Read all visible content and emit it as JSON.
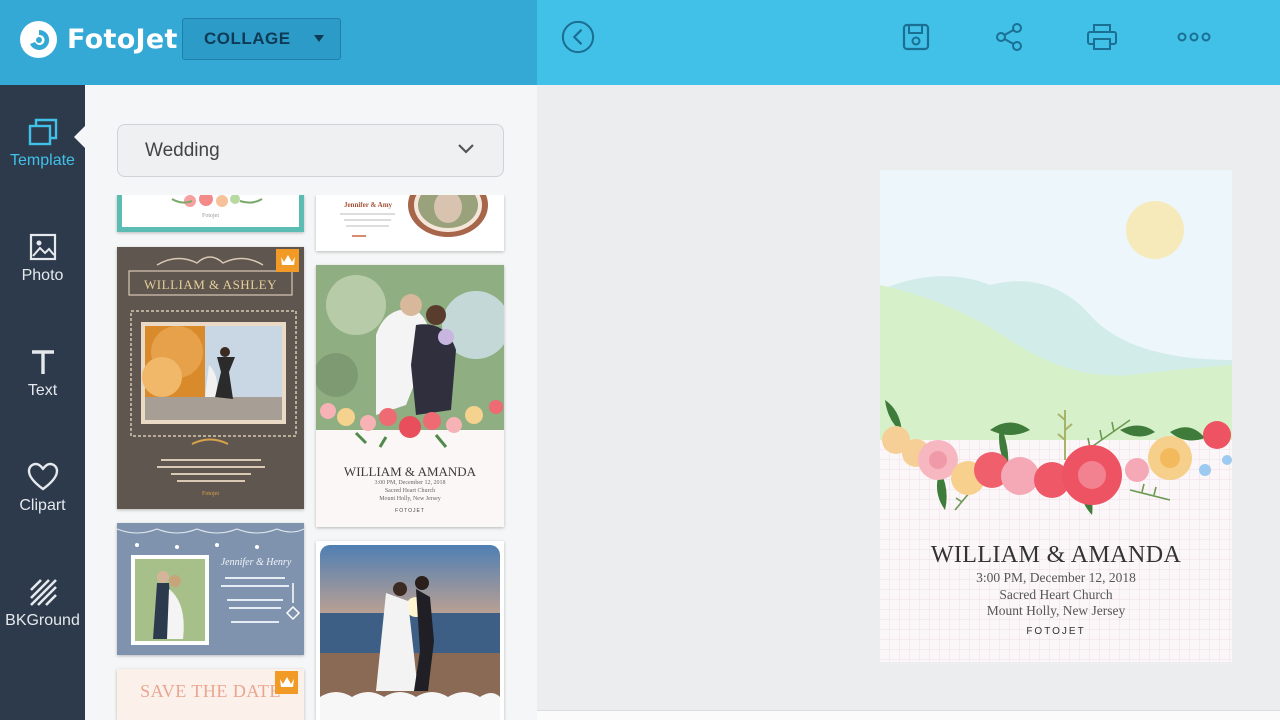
{
  "app": {
    "name": "FotoJet",
    "mode": "COLLAGE"
  },
  "toolbar": {
    "back": "back-icon",
    "save": "save-icon",
    "share": "share-icon",
    "print": "print-icon",
    "more": "more-icon"
  },
  "rail": {
    "items": [
      {
        "label": "Template",
        "icon": "template-icon",
        "active": true
      },
      {
        "label": "Photo",
        "icon": "photo-icon"
      },
      {
        "label": "Text",
        "icon": "text-icon"
      },
      {
        "label": "Clipart",
        "icon": "heart-icon"
      },
      {
        "label": "BKGround",
        "icon": "background-icon"
      }
    ]
  },
  "panel": {
    "category": "Wedding",
    "templates": [
      {
        "top_text": "Fotojet"
      },
      {
        "names": "Jennifer & Amy"
      },
      {
        "names": "WILLIAM & ASHLEY",
        "details": [
          "VILLA DESTE, LAKE COMO, ITALY",
          "SUNDAY 7 O'CLOCK SEPTEMBER 12, 2018",
          "DRESS CODE IS FORMAL",
          "WELCOME TO ATTEND"
        ],
        "brand": "Fotojet",
        "premium": true
      },
      {
        "names": "WILLIAM & AMANDA",
        "details": [
          "3:00 PM, December 12, 2018",
          "Sacred Heart Church",
          "Mount Holly, New Jersey"
        ],
        "brand": "FOTOJET"
      },
      {
        "names": "Jennifer & Henry"
      },
      {
        "names": ""
      },
      {
        "names": "SAVE THE DATE",
        "premium": true
      }
    ]
  },
  "design": {
    "names": "WILLIAM & AMANDA",
    "time": "3:00 PM, December 12, 2018",
    "venue": "Sacred Heart Church",
    "location": "Mount Holly, New Jersey",
    "brand": "FOTOJET"
  },
  "colors": {
    "topbar_left": "#35a9d6",
    "topbar_right": "#41c1e8",
    "rail": "#2d3a4b",
    "accent": "#41c1e8",
    "premium": "#f19a26"
  }
}
